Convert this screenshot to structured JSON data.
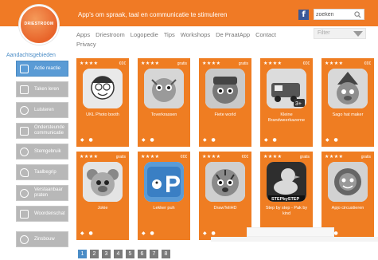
{
  "banner": {
    "tagline": "App's om spraak, taal en communicatie te stimuleren",
    "search_value": "zoeken"
  },
  "logo": {
    "text": "DRIESTROOM"
  },
  "nav": {
    "items": [
      "Apps",
      "Driestroom",
      "Logopedie",
      "Tips",
      "Workshops",
      "De PraatApp",
      "Contact",
      "Privacy"
    ]
  },
  "filter": {
    "label": "Filter"
  },
  "sidebar": {
    "title": "Aandachtsgebieden",
    "items": [
      {
        "label": "Actie reactie",
        "icon": "touch-icon",
        "active": true
      },
      {
        "label": "Taken leren",
        "icon": "task-icon",
        "active": false
      },
      {
        "label": "Luisteren",
        "icon": "ear-icon",
        "active": false
      },
      {
        "label": "Ondersteunde communicatie",
        "icon": "tablet-icon",
        "active": false
      },
      {
        "label": "Stemgebruik",
        "icon": "voice-icon",
        "active": false
      },
      {
        "label": "Taalbegrip",
        "icon": "head-icon",
        "active": false
      },
      {
        "label": "Verstaanbaar praten",
        "icon": "speech-icon",
        "active": false
      },
      {
        "label": "Woordenschat",
        "icon": "list-icon",
        "active": false
      },
      {
        "label": "Zinsbouw",
        "icon": "chat-icon",
        "active": false
      }
    ]
  },
  "apps": [
    {
      "title": "UKL Photo booth",
      "stars": "★★★★",
      "price": "€€€"
    },
    {
      "title": "Toverkrassen",
      "stars": "★★★★",
      "price": "gratis"
    },
    {
      "title": "Fiete world",
      "stars": "★★★★",
      "price": "gratis"
    },
    {
      "title": "Kleine Brandweerkazerne",
      "stars": "★★★★",
      "price": "€€€"
    },
    {
      "title": "Sago hat maker",
      "stars": "★★★★",
      "price": "€€€"
    },
    {
      "title": "Jokie",
      "stars": "★★★★",
      "price": "gratis"
    },
    {
      "title": "Lekker puh",
      "stars": "★★★★",
      "price": "€€€"
    },
    {
      "title": "DrawTeliHD",
      "stars": "★★★★",
      "price": "€€€"
    },
    {
      "title": "Step by step - Pak by kind",
      "stars": "★★★★",
      "price": "gratis"
    },
    {
      "title": "Apjo circustieren",
      "stars": "★★★★",
      "price": "gratis"
    }
  ],
  "pagination": {
    "pages": [
      "1",
      "2",
      "3",
      "4",
      "5",
      "6",
      "7",
      "8"
    ],
    "current": "1"
  },
  "colors": {
    "brand_orange": "#ef7d22",
    "accent_blue": "#5a9bd5",
    "sidebar_gray": "#b8b8b8"
  }
}
